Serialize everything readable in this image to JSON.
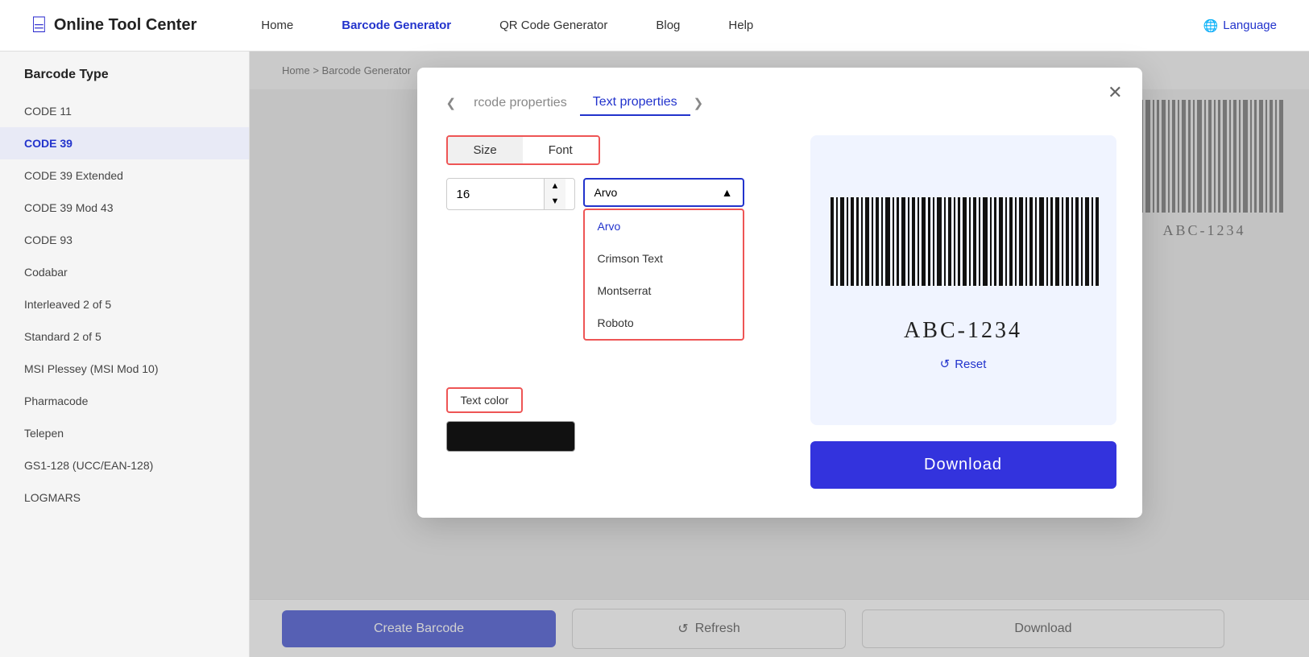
{
  "header": {
    "logo_text": "Online Tool Center",
    "nav": [
      {
        "label": "Home",
        "active": false
      },
      {
        "label": "Barcode Generator",
        "active": true
      },
      {
        "label": "QR Code Generator",
        "active": false
      },
      {
        "label": "Blog",
        "active": false
      },
      {
        "label": "Help",
        "active": false
      }
    ],
    "language_label": "Language"
  },
  "sidebar": {
    "title": "Barcode Type",
    "items": [
      {
        "label": "CODE 11",
        "active": false
      },
      {
        "label": "CODE 39",
        "active": true
      },
      {
        "label": "CODE 39 Extended",
        "active": false
      },
      {
        "label": "CODE 39 Mod 43",
        "active": false
      },
      {
        "label": "CODE 93",
        "active": false
      },
      {
        "label": "Codabar",
        "active": false
      },
      {
        "label": "Interleaved 2 of 5",
        "active": false
      },
      {
        "label": "Standard 2 of 5",
        "active": false
      },
      {
        "label": "MSI Plessey (MSI Mod 10)",
        "active": false
      },
      {
        "label": "Pharmacode",
        "active": false
      },
      {
        "label": "Telepen",
        "active": false
      },
      {
        "label": "GS1-128 (UCC/EAN-128)",
        "active": false
      },
      {
        "label": "LOGMARS",
        "active": false
      }
    ]
  },
  "breadcrumb": {
    "home": "Home",
    "separator": ">",
    "current": "Barcode Generator"
  },
  "modal": {
    "prev_tab": "rcode properties",
    "active_tab": "Text properties",
    "next_arrow": ">",
    "subtabs": [
      "Size",
      "Font"
    ],
    "size_value": "16",
    "font_selected": "Arvo",
    "font_options": [
      "Arvo",
      "Crimson Text",
      "Montserrat",
      "Roboto"
    ],
    "text_color_label": "Text color",
    "barcode_text": "ABC-1234",
    "reset_label": "Reset",
    "download_label": "Download"
  },
  "bottom_bar": {
    "create_label": "Create Barcode",
    "refresh_label": "Refresh",
    "download_label": "Download"
  }
}
